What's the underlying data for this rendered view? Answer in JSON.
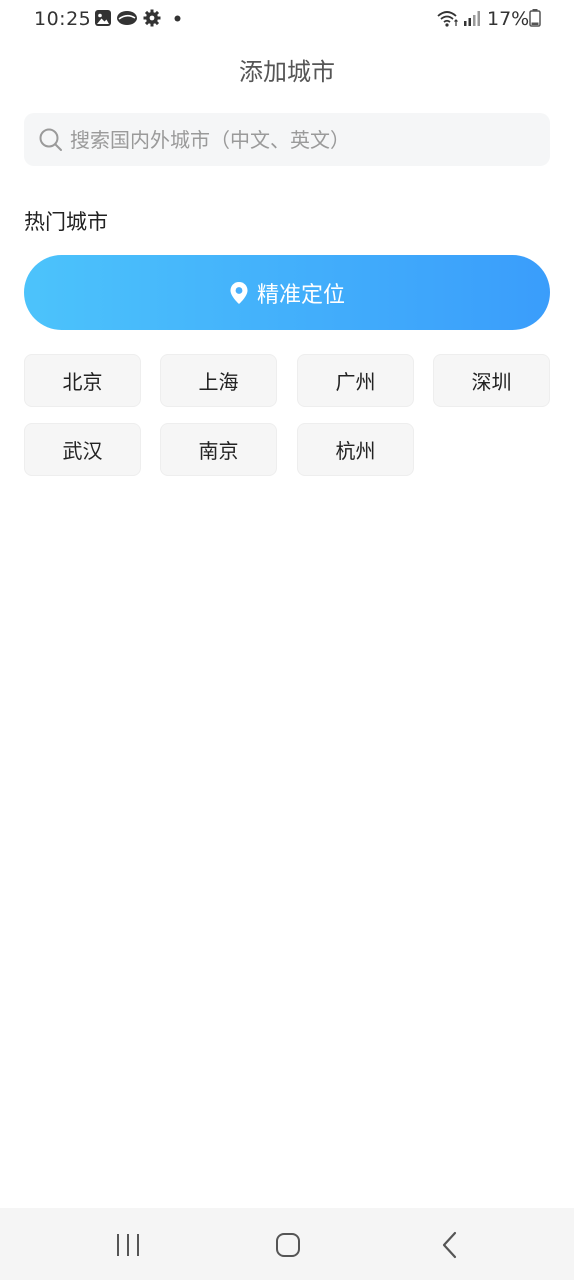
{
  "status_bar": {
    "time": "10:25",
    "battery": "17%",
    "left_icons": [
      "gallery-icon",
      "cloud-icon",
      "settings-icon",
      "notification-dot-icon"
    ],
    "right_icons": [
      "wifi-icon",
      "signal-icon",
      "battery-icon"
    ]
  },
  "header": {
    "title": "添加城市"
  },
  "search": {
    "placeholder": "搜索国内外城市（中文、英文）",
    "value": ""
  },
  "hot_cities": {
    "title": "热门城市",
    "locate_label": "精准定位",
    "locate_icon": "location-pin-icon",
    "cities": [
      "北京",
      "上海",
      "广州",
      "深圳",
      "武汉",
      "南京",
      "杭州"
    ]
  },
  "nav_bar": {
    "buttons": [
      "recent-apps-icon",
      "home-icon",
      "back-icon"
    ]
  },
  "colors": {
    "accent_start": "#4cc3fb",
    "accent_end": "#3a9dfb",
    "chip_bg": "#f6f6f6",
    "search_bg": "#f5f6f7"
  }
}
